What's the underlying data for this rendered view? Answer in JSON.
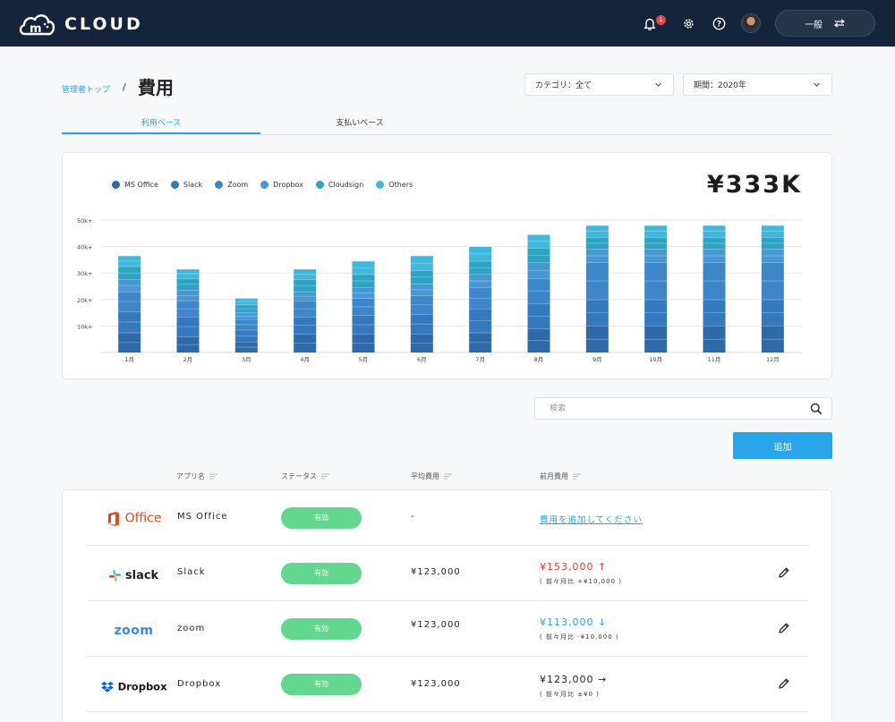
{
  "header": {
    "logo_text": "CLOUD",
    "notification_count": "1",
    "role_label": "一般"
  },
  "page": {
    "breadcrumb_link": "管理者トップ",
    "breadcrumb_sep": "/",
    "title": "費用",
    "category_select": "カテゴリ：全て",
    "period_select": "期間：2020年"
  },
  "tabs": [
    {
      "label": "利用ベース",
      "active": true
    },
    {
      "label": "支払いベース",
      "active": false
    }
  ],
  "chart_data": {
    "type": "bar",
    "stacked": true,
    "total_label": "¥333K",
    "categories": [
      "1月",
      "2月",
      "3月",
      "4月",
      "5月",
      "6月",
      "7月",
      "8月",
      "9月",
      "10月",
      "11月",
      "12月"
    ],
    "y_ticks": [
      "10k+",
      "20k+",
      "30k+",
      "40k+",
      "50k+"
    ],
    "ylim": [
      0,
      50000
    ],
    "grid": true,
    "legend_position": "top-left",
    "series": [
      {
        "name": "MS Office",
        "color": "#2f6aa8",
        "values": [
          7500,
          6000,
          4000,
          7000,
          7000,
          7000,
          7500,
          9000,
          10000,
          10000,
          10000,
          10000
        ]
      },
      {
        "name": "Slack",
        "color": "#3478bd",
        "values": [
          8000,
          7500,
          4500,
          6500,
          7000,
          7500,
          9000,
          9500,
          10000,
          10000,
          10000,
          10000
        ]
      },
      {
        "name": "Zoom",
        "color": "#3c86c9",
        "values": [
          7500,
          6000,
          4000,
          6000,
          6500,
          7000,
          8000,
          9500,
          14000,
          14000,
          14000,
          14000
        ]
      },
      {
        "name": "Dropbox",
        "color": "#4797d2",
        "values": [
          4500,
          4000,
          2500,
          3500,
          4000,
          4500,
          5000,
          6000,
          5000,
          5000,
          5000,
          5000
        ]
      },
      {
        "name": "Cloudsign",
        "color": "#2fa3c4",
        "values": [
          5000,
          4500,
          3000,
          4500,
          5000,
          5000,
          5000,
          5500,
          4500,
          4500,
          4500,
          4500
        ]
      },
      {
        "name": "Others",
        "color": "#41b7db",
        "values": [
          4000,
          3500,
          2500,
          4000,
          5000,
          5500,
          5500,
          5000,
          4500,
          4500,
          4500,
          4500
        ]
      }
    ]
  },
  "search": {
    "placeholder": "検索"
  },
  "add_button": "追加",
  "table": {
    "columns": [
      "アプリ名",
      "ステータス",
      "平均費用",
      "前月費用"
    ],
    "rows": [
      {
        "logo": "Office",
        "name": "MS Office",
        "status": "有効",
        "avg": "-",
        "prev_link": "費用を追加してください"
      },
      {
        "logo": "slack",
        "name": "Slack",
        "status": "有効",
        "avg": "¥123,000",
        "prev": "¥153,000 ↑",
        "prev_sub": "( 前々月比 +¥10,000 )",
        "trend_color": "#e53935"
      },
      {
        "logo": "zoom",
        "name": "zoom",
        "status": "有効",
        "avg": "¥123,000",
        "prev": "¥113,000 ↓",
        "prev_sub": "( 前々月比 -¥10,000 )",
        "trend_color": "#2ba3e0"
      },
      {
        "logo": "Dropbox",
        "name": "Dropbox",
        "status": "有効",
        "avg": "¥123,000",
        "prev": "¥123,000 →",
        "prev_sub": "( 前々月比 ±¥0 )",
        "trend_color": "#222222"
      }
    ]
  }
}
